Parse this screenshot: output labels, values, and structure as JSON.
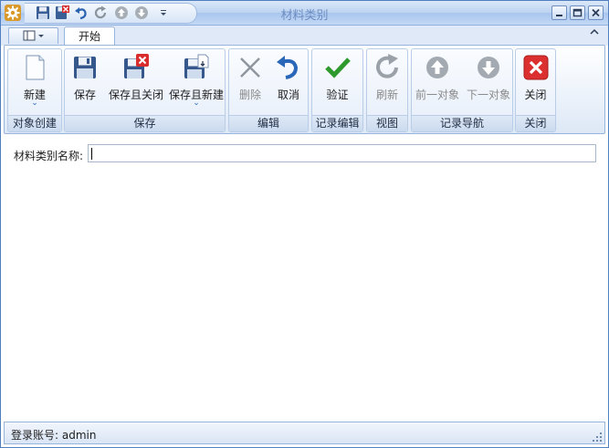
{
  "window": {
    "title": "材料类别"
  },
  "tabs": {
    "start": "开始"
  },
  "ribbon": {
    "groups": {
      "create": "对象创建",
      "save": "保存",
      "edit": "编辑",
      "record_edit": "记录编辑",
      "view": "视图",
      "record_nav": "记录导航",
      "close": "关闭"
    },
    "buttons": {
      "new": "新建",
      "save": "保存",
      "save_close": "保存且关闭",
      "save_new": "保存且新建",
      "delete": "删除",
      "cancel": "取消",
      "validate": "验证",
      "refresh": "刷新",
      "prev": "前一对象",
      "next": "下一对象",
      "close": "关闭"
    },
    "dropdown_marker": "⌄"
  },
  "form": {
    "name_label": "材料类别名称:",
    "name_value": ""
  },
  "status": {
    "login": "登录账号: admin"
  },
  "colors": {
    "accent": "#4f7fbf",
    "ribbon_border": "#98b4dc"
  }
}
